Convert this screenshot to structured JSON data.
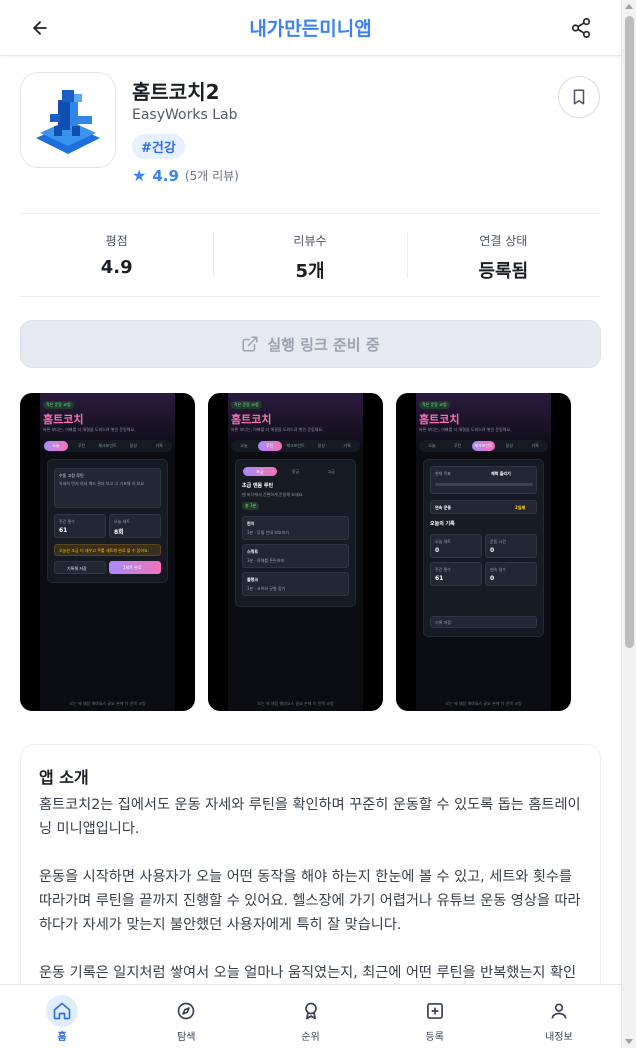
{
  "header": {
    "title": "내가만든미니앱"
  },
  "app": {
    "name": "홈트코치2",
    "developer": "EasyWorks Lab",
    "tag": "#건강",
    "rating": "4.9",
    "review_count": "(5개 리뷰)"
  },
  "stats": [
    {
      "label": "평점",
      "value": "4.9"
    },
    {
      "label": "리뷰수",
      "value": "5개"
    },
    {
      "label": "연결 상태",
      "value": "등록됨"
    }
  ],
  "run_button": {
    "label": "실행 링크 준비 중"
  },
  "screenshots": {
    "badge": "작은 운동 코칭",
    "title": "홈트코치",
    "desc": "바른 보다는, 아빠를 더 해결을 도와드려 쌓인 운동해요.",
    "tabs": [
      "오늘",
      "루틴",
      "체크포인트",
      "달성",
      "기록"
    ],
    "footer": "오는 에 채팅 해야요스 끝요 손에 이 인덱 코칭",
    "shot1": {
      "card_title": "수동 고정 루틴",
      "card_desc": "자세히 먼저 하세 해드 관리 보고 고 기초해 어 보요",
      "box1_label": "주간 횟수",
      "box1_value": "61",
      "box2_label": "오늘 세트",
      "box2_value": "8회",
      "notice": "오늘은 조금 더 세우고 주를 세트해 완료 할 수 있어요.",
      "btn1": "기록해 저장",
      "btn2": "1세트 완료"
    },
    "shot2": {
      "seg": [
        "초급",
        "중급",
        "고급"
      ],
      "title": "초급 맨몸 루틴",
      "desc": "맨 바닥에서 간편하게 운동해 보세요.",
      "chip": "총 3분",
      "items": [
        {
          "name": "런지",
          "sub": "3분 · 무릎 인대 보호하기"
        },
        {
          "name": "스쿼트",
          "sub": "3분 · 하체를 튼튼하게"
        },
        {
          "name": "플랭크",
          "sub": "1분 · 코어와 균형 잡기"
        }
      ]
    },
    "shot3": {
      "row_label": "현재 목표",
      "row_value": "체력 올리기",
      "streak_label": "연속 운동",
      "streak_value": "2일째",
      "section": "오늘의 기록",
      "boxes": [
        {
          "label": "오늘 세트",
          "value": "0"
        },
        {
          "label": "운동 시간",
          "value": "0"
        },
        {
          "label": "주간 횟수",
          "value": "61"
        },
        {
          "label": "연속 일수",
          "value": "0"
        }
      ],
      "bottom": "기록 저장"
    }
  },
  "intro": {
    "heading": "앱 소개",
    "body": "홈트코치2는 집에서도 운동 자세와 루틴을 확인하며 꾸준히 운동할 수 있도록 돕는 홈트레이닝 미니앱입니다.\n\n운동을 시작하면 사용자가 오늘 어떤 동작을 해야 하는지 한눈에 볼 수 있고, 세트와 횟수를 따라가며 루틴을 끝까지 진행할 수 있어요. 헬스장에 가기 어렵거나 유튜브 운동 영상을 따라 하다가 자세가 맞는지 불안했던 사용자에게 특히 잘 맞습니다.\n\n운동 기록은 일지처럼 쌓여서 오늘 얼마나 움직였는지, 최근에 어떤 루틴을 반복했는지 확인할 수 있습니다. 짧은 시간이라도 매일 이어가는 경험을 만들기 좋고, 운동 초보자도"
  },
  "nav": [
    {
      "label": "홈",
      "icon": "home-icon",
      "active": true
    },
    {
      "label": "탐색",
      "icon": "compass-icon",
      "active": false
    },
    {
      "label": "순위",
      "icon": "medal-icon",
      "active": false
    },
    {
      "label": "등록",
      "icon": "plus-square-icon",
      "active": false
    },
    {
      "label": "내정보",
      "icon": "user-icon",
      "active": false
    }
  ],
  "colors": {
    "accent": "#3b82f6",
    "tag_bg": "#e6f0ff",
    "button_disabled": "#e6e9ef"
  }
}
